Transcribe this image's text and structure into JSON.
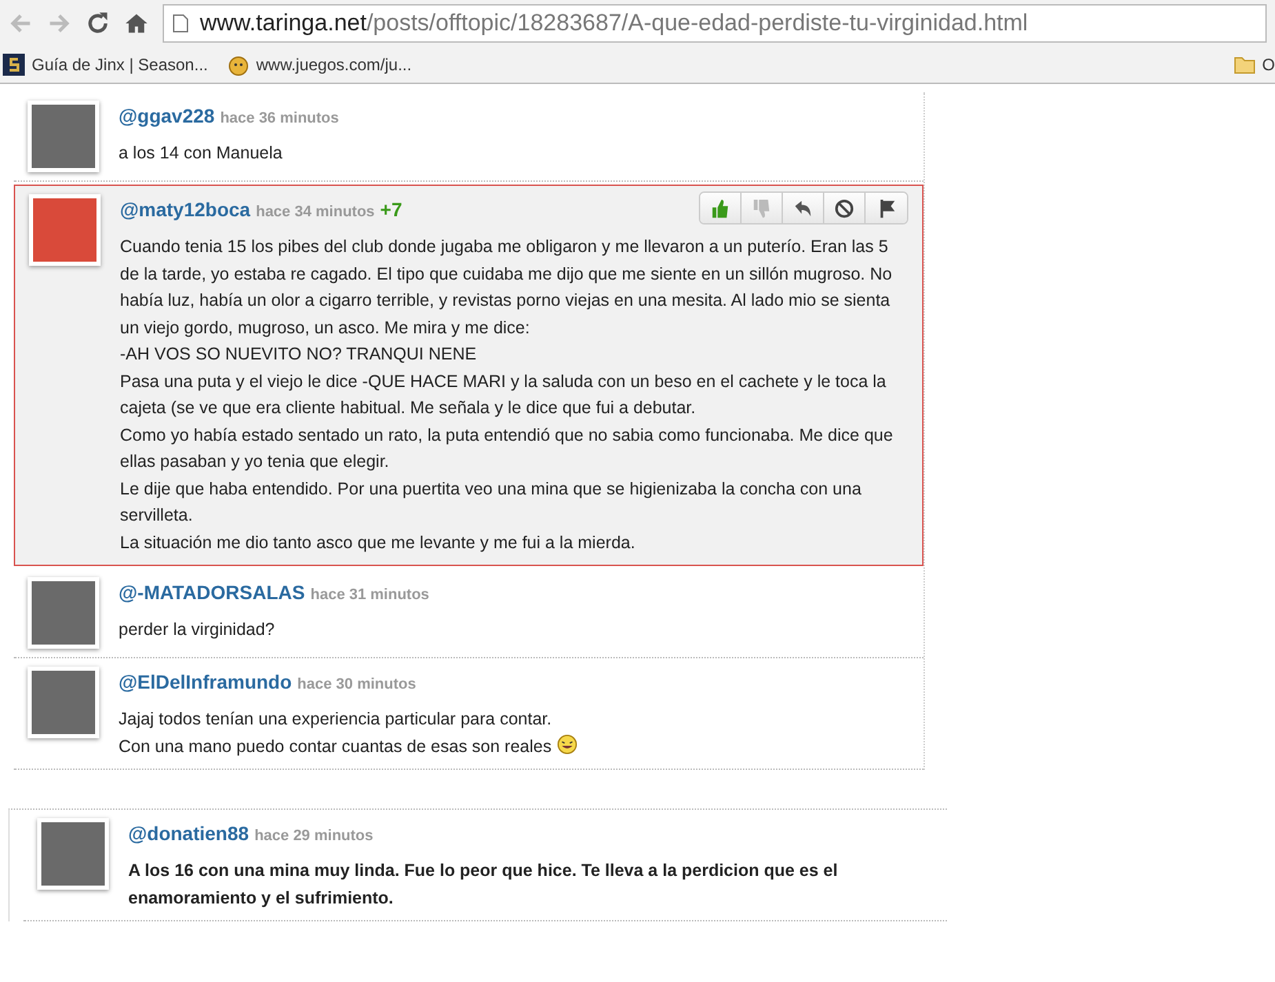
{
  "browser": {
    "url_host": "www.taringa.net",
    "url_path": "/posts/offtopic/18283687/A-que-edad-perdiste-tu-virginidad.html",
    "bookmarks": [
      {
        "kind": "site",
        "label": "Guía de Jinx | Season..."
      },
      {
        "kind": "game",
        "label": "www.juegos.com/ju..."
      },
      {
        "kind": "folder",
        "label": "O"
      }
    ]
  },
  "comments": [
    {
      "user": "@ggav228",
      "time": "hace 36 minutos",
      "highlighted": false,
      "bold": false,
      "emoji": false,
      "lines": [
        "a los 14 con Manuela"
      ]
    },
    {
      "user": "@maty12boca",
      "time": "hace 34 minutos",
      "score": "+7",
      "highlighted": true,
      "bold": false,
      "emoji": false,
      "actions": [
        {
          "kind": "like",
          "active": true
        },
        {
          "kind": "dislike",
          "active": false
        },
        {
          "kind": "reply",
          "active": false
        },
        {
          "kind": "block",
          "active": false
        },
        {
          "kind": "flag",
          "active": false
        }
      ],
      "lines": [
        "Cuando tenia 15 los pibes del club donde jugaba me obligaron y me llevaron a un puterío. Eran las 5 de la tarde, yo estaba re cagado. El tipo que cuidaba me dijo que me siente en un sillón mugroso. No había luz, había un olor a cigarro terrible, y revistas porno viejas en una mesita. Al lado mio se sienta un viejo gordo, mugroso, un asco. Me mira y me dice:",
        "-AH VOS SO NUEVITO NO? TRANQUI NENE",
        "Pasa una puta y el viejo le dice -QUE HACE MARI y la saluda con un beso en el cachete y le toca la cajeta (se ve que era cliente habitual. Me señala y le dice que fui a debutar.",
        "Como yo había estado sentado un rato, la puta entendió que no sabia como funcionaba. Me dice que ellas pasaban y yo tenia que elegir.",
        "Le dije que haba entendido. Por una puertita veo una mina que se higienizaba la concha con una servilleta.",
        "La situación me dio tanto asco que me levante y me fui a la mierda."
      ]
    },
    {
      "user": "@-MATADORSALAS",
      "time": "hace 31 minutos",
      "highlighted": false,
      "bold": false,
      "emoji": false,
      "lines": [
        "perder la virginidad?"
      ]
    },
    {
      "user": "@ElDelInframundo",
      "time": "hace 30 minutos",
      "highlighted": false,
      "bold": false,
      "emoji": true,
      "lines": [
        "Jajaj todos tenían una experiencia particular para contar.",
        "Con una mano puedo contar cuantas de esas son reales"
      ]
    }
  ],
  "second_section": [
    {
      "user": "@donatien88",
      "time": "hace 29 minutos",
      "highlighted": false,
      "bold": true,
      "lines": [
        "A los 16 con una mina muy linda. Fue lo peor que hice. Te lleva a la perdicion que es el enamoramiento y el sufrimiento."
      ]
    }
  ]
}
